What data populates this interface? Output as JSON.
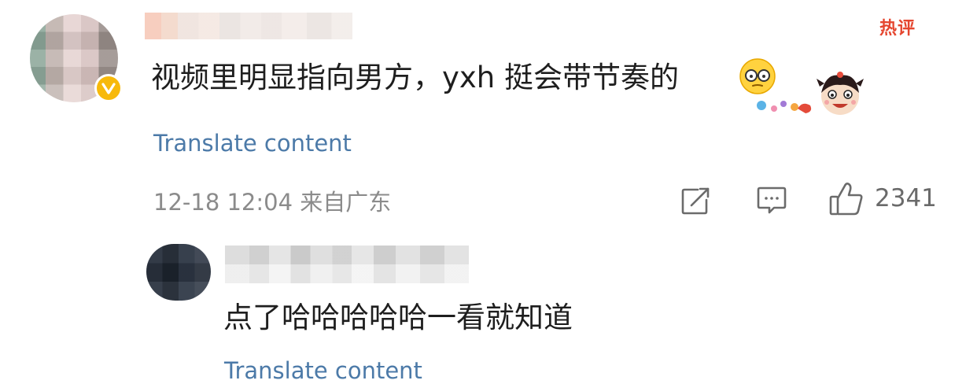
{
  "comment": {
    "hot_tag": "热评",
    "text": "视频里明显指向男方，yxh 挺会带节奏的",
    "translate_label": "Translate content",
    "meta": "12-18 12:04 来自广东",
    "like_count": "2341",
    "icons": {
      "share": "share-edit-icon",
      "comment": "comment-icon",
      "like": "thumbs-up-icon",
      "verified": "verified-badge-icon",
      "emoji": "glasses-face-emoji-icon",
      "sticker": "cartoon-sticker"
    }
  },
  "reply": {
    "text": "点了哈哈哈哈哈一看就知道",
    "translate_label": "Translate content"
  },
  "colors": {
    "link": "#4c7aa8",
    "meta": "#8b8b8b",
    "hot": "#e5462f",
    "verified": "#f7b90b"
  }
}
